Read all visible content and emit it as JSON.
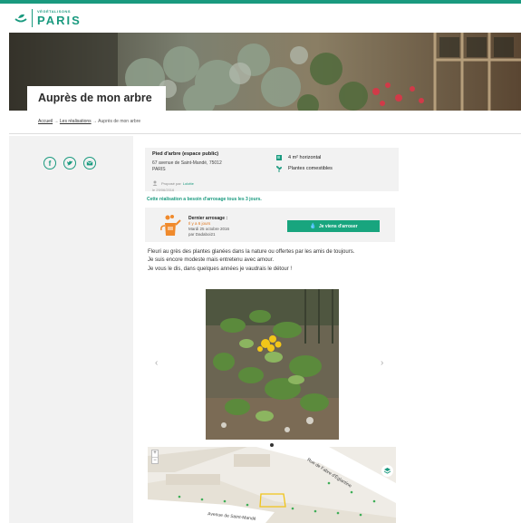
{
  "brand": {
    "line1": "VÉGÉTALISONS",
    "line2": "PARIS",
    "color": "#1a9a7f"
  },
  "page": {
    "title": "Auprès de mon arbre"
  },
  "breadcrumb": {
    "home": "Accueil",
    "sep1": "→",
    "section": "Les réalisations",
    "sep2": "→",
    "current": "Auprès de mon arbre"
  },
  "share": {
    "facebook_icon": "facebook-icon",
    "twitter_icon": "twitter-icon",
    "email_icon": "mail-icon"
  },
  "info": {
    "type": "Pied d'arbre (espace public)",
    "address_line1": "67 avenue de Saint-Mandé, 75012",
    "address_line2": "PARIS",
    "proposed_prefix": "Proposé par",
    "proposed_by": "Lolotte",
    "date": "le 29/06/2016",
    "features": [
      {
        "icon": "surface-icon",
        "label": "4 m² horizontal"
      },
      {
        "icon": "plant-icon",
        "label": "Plantes comestibles"
      }
    ]
  },
  "watering": {
    "note": "Cette réalisation a besoin d'arrosage tous les 3 jours.",
    "last_label": "Dernier arrosage :",
    "ago": "Il y a 6 jours",
    "date": "Mardi 25 octobre 2016",
    "by": "par Dadaboi21",
    "button": "Je viens d'arroser",
    "button_color": "#18a57e"
  },
  "description": {
    "p1": "Fleuri au grès des plantes glanées dans la nature ou offertes par les amis de toujours.",
    "p2": "Je suis encore modeste mais entretenu avec amour.",
    "p3": "Je vous le dis, dans quelques années je vaudrais le détour !"
  },
  "carousel": {
    "prev": "‹",
    "next": "›"
  },
  "map": {
    "zoom_in": "+",
    "zoom_out": "−",
    "street1": "Rue de Fabre d'Églantine",
    "street2": "Avenue de Saint-Mandé"
  }
}
